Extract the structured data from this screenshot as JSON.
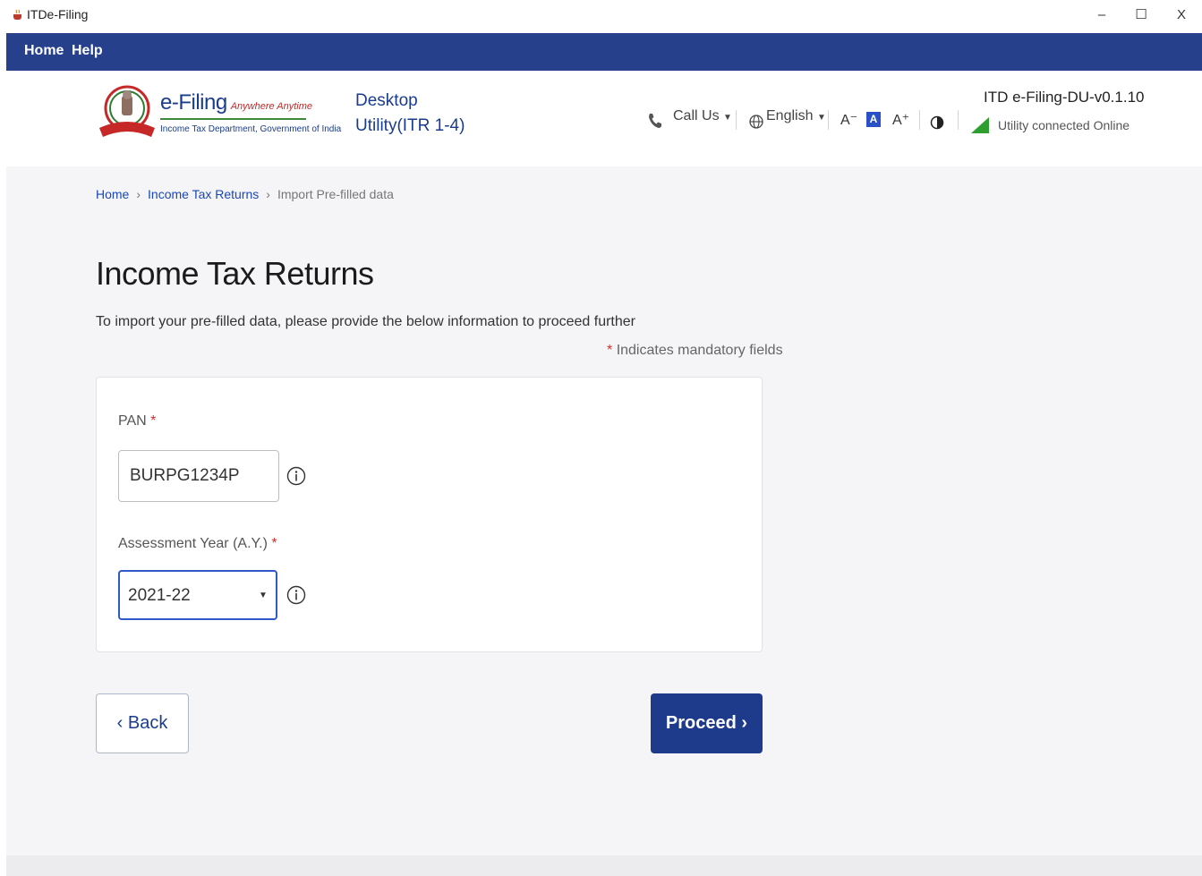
{
  "window": {
    "title": "ITDe-Filing",
    "minimize_glyph": "–",
    "maximize_glyph": "☐",
    "close_glyph": "X"
  },
  "menubar": {
    "home": "Home",
    "help": "Help"
  },
  "header": {
    "brand_name": "e-Filing",
    "brand_tagline": "Anywhere Anytime",
    "brand_dept": "Income Tax Department, Government of India",
    "product_line1": "Desktop",
    "product_line2": "Utility(ITR 1-4)",
    "call_us": "Call Us",
    "language": "English",
    "font_decrease": "A⁻",
    "font_normal": "A",
    "font_increase": "A⁺",
    "version": "ITD e-Filing-DU-v0.1.10",
    "connection_status": "Utility connected Online"
  },
  "breadcrumb": {
    "home": "Home",
    "section": "Income Tax Returns",
    "current": "Import Pre-filled data"
  },
  "page": {
    "title": "Income Tax Returns",
    "subtitle": "To import your pre-filled data, please provide the below information to proceed further",
    "mandatory_star": "*",
    "mandatory_note": "Indicates mandatory fields"
  },
  "form": {
    "pan_label": "PAN",
    "pan_value": "BURPG1234P",
    "ay_label": "Assessment Year (A.Y.)",
    "ay_value": "2021-22",
    "required_marker": "*"
  },
  "actions": {
    "back": "‹ Back",
    "proceed": "Proceed ›"
  },
  "colors": {
    "menubar": "#27408b",
    "brand_blue": "#1a3c8f",
    "primary_button": "#1e3a8a",
    "required_red": "#d32f2f",
    "online_green": "#2e9e2e"
  }
}
